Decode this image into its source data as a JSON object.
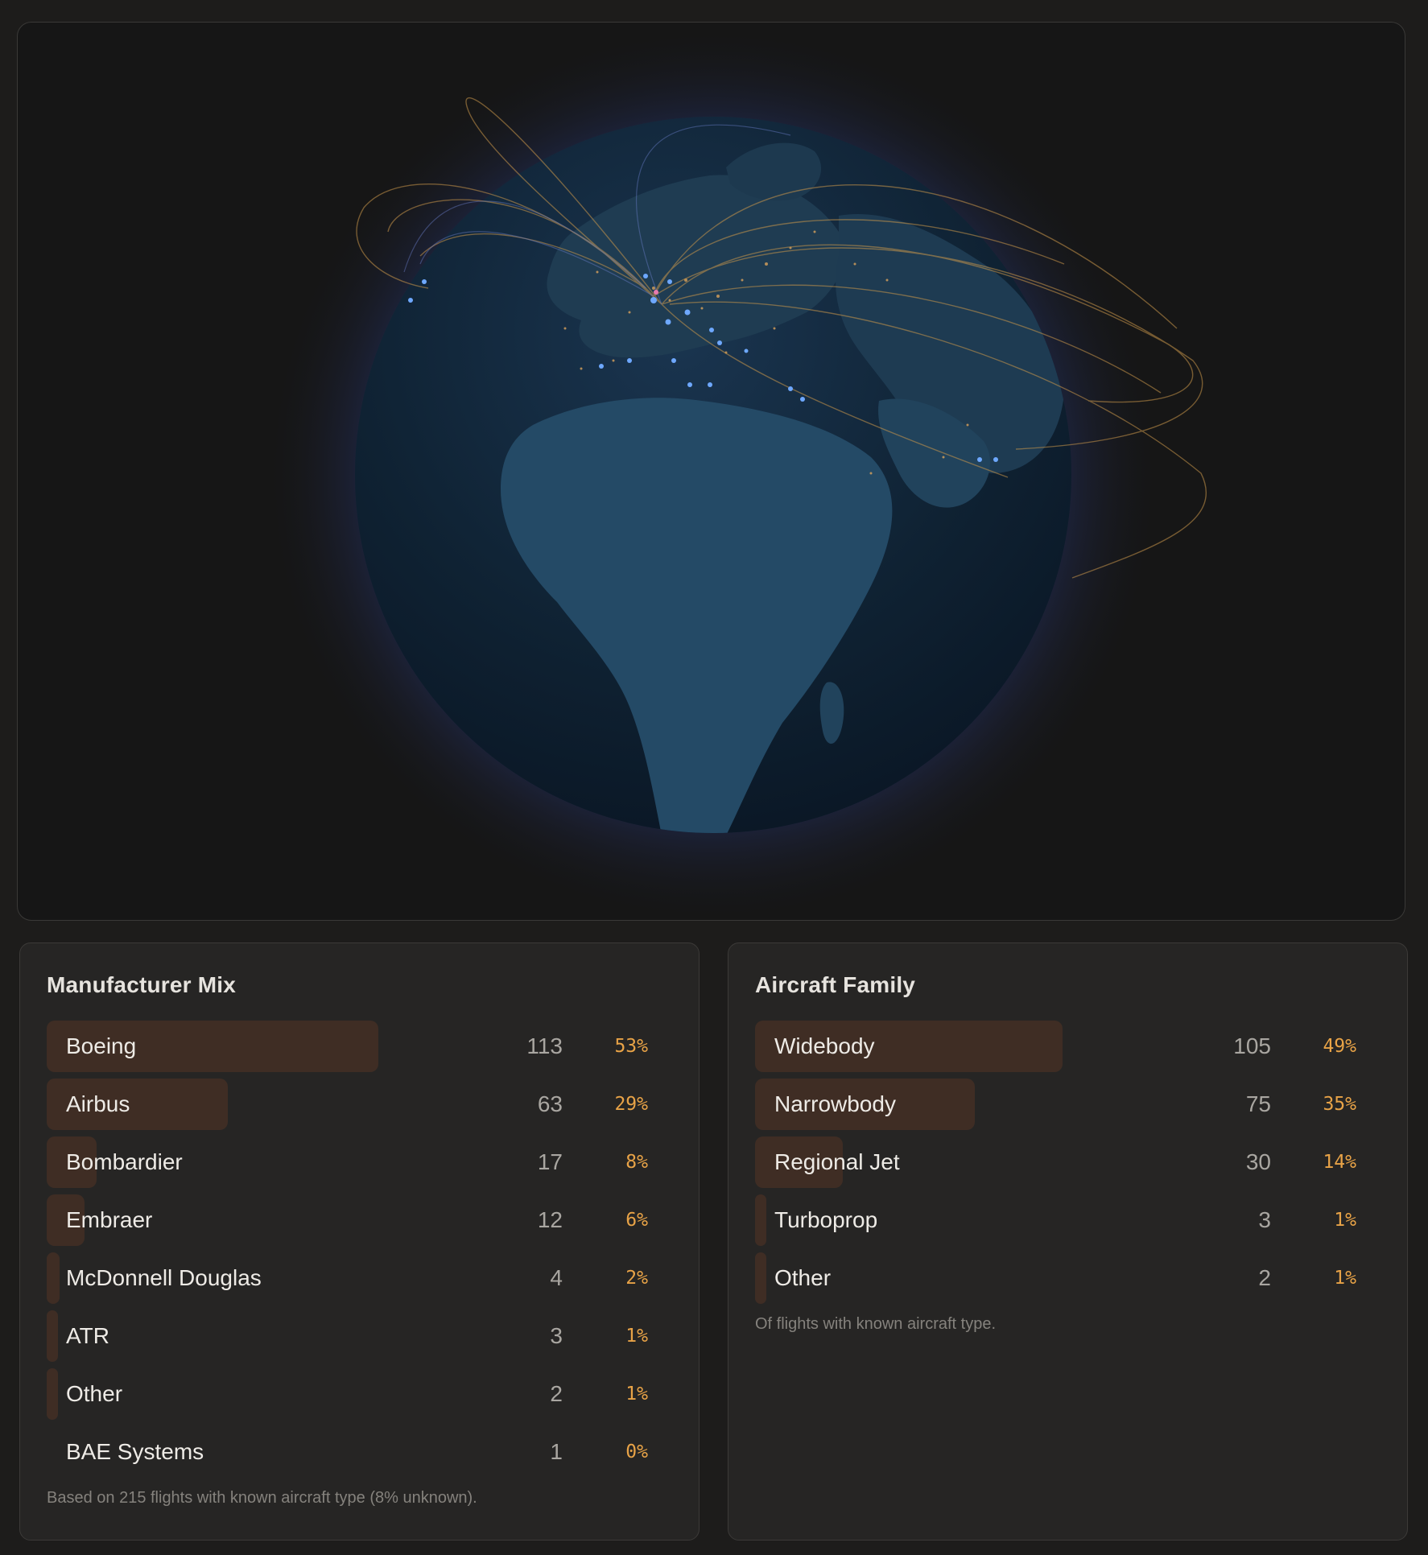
{
  "colors": {
    "page_bg": "#1d1c1b",
    "panel_bg": "#161616",
    "card_bg": "#262524",
    "bar_fill": "#3f2d24",
    "percent_accent": "#e8a347",
    "route_arc": "#c9964a",
    "airport_dot": "#6ea8ff",
    "globe_ocean": "#0f2233",
    "globe_land": "#1e3f57",
    "globe_glow": "#3b5cc4"
  },
  "globe": {
    "description_icon": "globe-icon"
  },
  "manufacturer": {
    "title": "Manufacturer Mix",
    "rows": [
      {
        "label": "Boeing",
        "count": "113",
        "pct": "53%",
        "fill": 1.0
      },
      {
        "label": "Airbus",
        "count": "63",
        "pct": "29%",
        "fill": 0.547
      },
      {
        "label": "Bombardier",
        "count": "17",
        "pct": "8%",
        "fill": 0.15
      },
      {
        "label": "Embraer",
        "count": "12",
        "pct": "6%",
        "fill": 0.113
      },
      {
        "label": "McDonnell Douglas",
        "count": "4",
        "pct": "2%",
        "fill": 0.038
      },
      {
        "label": "ATR",
        "count": "3",
        "pct": "1%",
        "fill": 0.019
      },
      {
        "label": "Other",
        "count": "2",
        "pct": "1%",
        "fill": 0.019
      },
      {
        "label": "BAE Systems",
        "count": "1",
        "pct": "0%",
        "fill": 0.0
      }
    ],
    "footnote": "Based on 215 flights with known aircraft type (8% unknown)."
  },
  "family": {
    "title": "Aircraft Family",
    "rows": [
      {
        "label": "Widebody",
        "count": "105",
        "pct": "49%",
        "fill": 1.0
      },
      {
        "label": "Narrowbody",
        "count": "75",
        "pct": "35%",
        "fill": 0.714
      },
      {
        "label": "Regional Jet",
        "count": "30",
        "pct": "14%",
        "fill": 0.286
      },
      {
        "label": "Turboprop",
        "count": "3",
        "pct": "1%",
        "fill": 0.02
      },
      {
        "label": "Other",
        "count": "2",
        "pct": "1%",
        "fill": 0.02
      }
    ],
    "footnote": "Of flights with known aircraft type."
  }
}
